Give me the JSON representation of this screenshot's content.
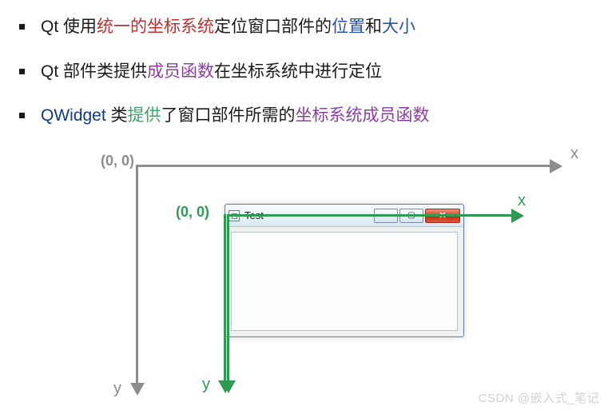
{
  "bullets": [
    {
      "p0": "Qt 使用",
      "p1": "统一的坐标系统",
      "p2": "定位窗口部件的",
      "p3": "位置",
      "p4": "和",
      "p5": "大小"
    },
    {
      "p0": "Qt 部件类提供",
      "p1": "成员函数",
      "p2": "在坐标系统中进行定位"
    },
    {
      "p0": "QWidget",
      "p1": " 类",
      "p2": "提供",
      "p3": "了窗口部件所需的",
      "p4": "坐标系统成员函数"
    }
  ],
  "diagram": {
    "outer": {
      "origin": "(0, 0)",
      "x": "x",
      "y": "y"
    },
    "inner": {
      "origin": "(0, 0)",
      "x": "x",
      "y": "y"
    },
    "window": {
      "title": "Test"
    }
  },
  "watermark": "CSDN @嵌入式_笔记"
}
